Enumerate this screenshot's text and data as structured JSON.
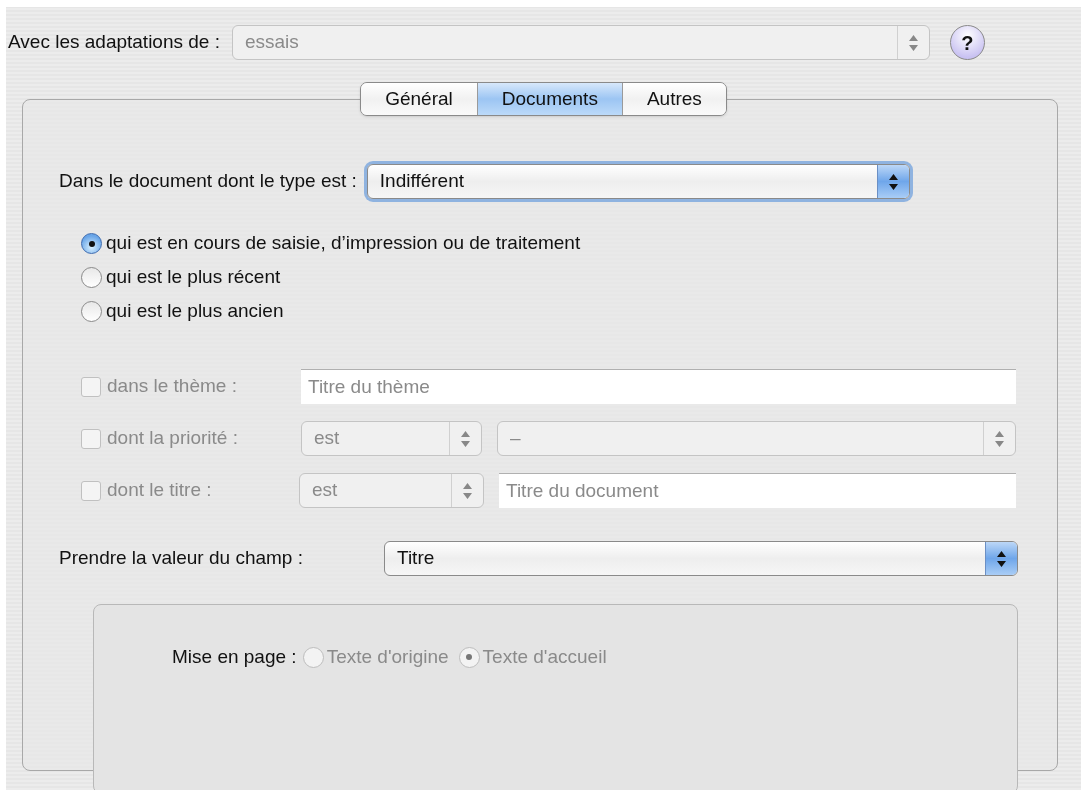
{
  "adaptations": {
    "label": "Avec les adaptations de :",
    "value": "essais",
    "disabled": true
  },
  "help_button": {
    "label": "?"
  },
  "tabs": [
    {
      "label": "Général",
      "selected": false
    },
    {
      "label": "Documents",
      "selected": true
    },
    {
      "label": "Autres",
      "selected": false
    }
  ],
  "document_type": {
    "label": "Dans le document dont le type est :",
    "value": "Indifférent",
    "focused": true
  },
  "document_choice": [
    {
      "label": "qui est en cours de saisie, d’impression ou de traitement",
      "selected": true
    },
    {
      "label": "qui est le plus récent",
      "selected": false
    },
    {
      "label": "qui est le plus ancien",
      "selected": false
    }
  ],
  "filters": [
    {
      "kind": "text",
      "label": "dans le thème :",
      "checked": false,
      "disabled": true,
      "placeholder": "Titre du thème"
    },
    {
      "kind": "select_select",
      "label": "dont la priorité :",
      "checked": false,
      "disabled": true,
      "operator": "est",
      "value": "–"
    },
    {
      "kind": "select_text",
      "label": "dont le titre :",
      "checked": false,
      "disabled": true,
      "operator": "est",
      "placeholder": "Titre du document"
    }
  ],
  "field": {
    "label": "Prendre la valeur du champ :",
    "value": "Titre"
  },
  "layout": {
    "label": "Mise en page :",
    "disabled": true,
    "options": [
      {
        "label": "Texte d'origine",
        "selected": false
      },
      {
        "label": "Texte d'accueil",
        "selected": true
      }
    ]
  }
}
